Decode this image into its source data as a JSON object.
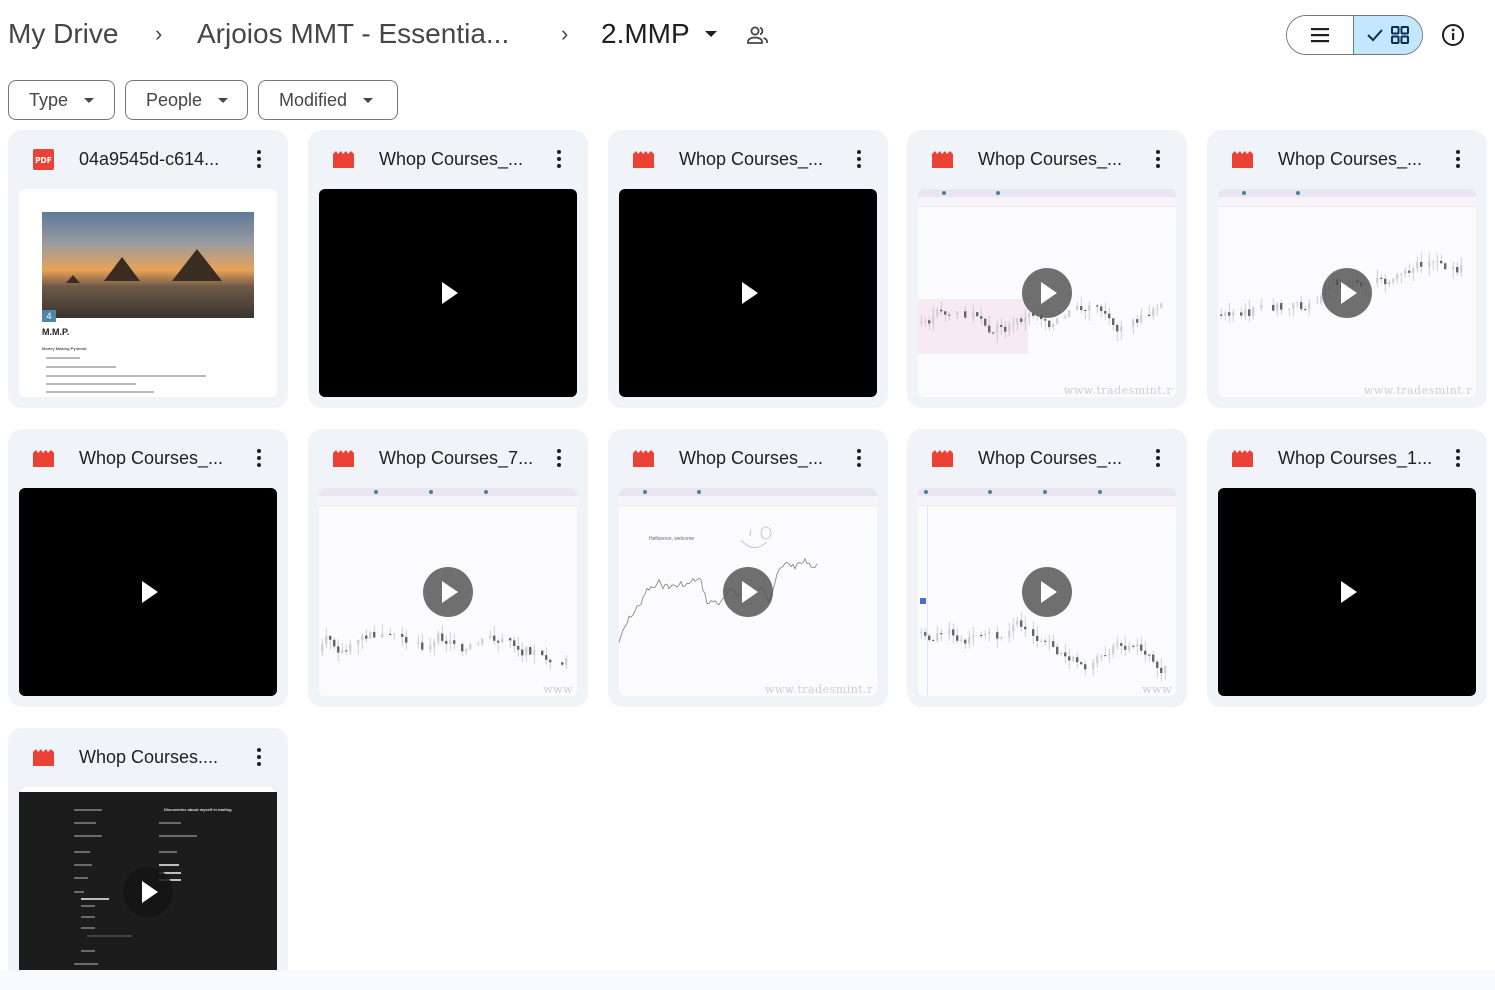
{
  "breadcrumb": {
    "items": [
      {
        "label": "My Drive"
      },
      {
        "label": "Arjoios MMT - Essentia..."
      },
      {
        "label": "2.MMP"
      }
    ],
    "separator": "›",
    "current_has_dropdown": true,
    "current_shared_icon": "shared-folder-icon"
  },
  "view_toggle": {
    "options": [
      {
        "name": "list",
        "icon": "list-icon",
        "selected": false
      },
      {
        "name": "grid",
        "icon": "grid-icon",
        "selected": true,
        "check_icon": "checkmark-icon"
      }
    ],
    "selected_color": "#c2e7ff"
  },
  "info_button": {
    "icon": "info-icon"
  },
  "filters": [
    {
      "label": "Type"
    },
    {
      "label": "People"
    },
    {
      "label": "Modified"
    }
  ],
  "files": [
    {
      "name": "04a9545d-c614...",
      "type": "pdf",
      "icon": "pdf-icon",
      "icon_text": "PDF",
      "thumbnail": "pdf-document",
      "preview": {
        "heading": "M.M.P.",
        "subtitle": "Money Making Pyramid",
        "badge": "4"
      }
    },
    {
      "name": "Whop Courses_...",
      "type": "video",
      "icon": "video-icon",
      "thumbnail": "black"
    },
    {
      "name": "Whop Courses_...",
      "type": "video",
      "icon": "video-icon",
      "thumbnail": "black"
    },
    {
      "name": "Whop Courses_...",
      "type": "video",
      "icon": "video-icon",
      "thumbnail": "chart",
      "watermark": "www.tradesmint.r"
    },
    {
      "name": "Whop Courses_...",
      "type": "video",
      "icon": "video-icon",
      "thumbnail": "chart",
      "watermark": "www.tradesmint.r"
    },
    {
      "name": "Whop Courses_...",
      "type": "video",
      "icon": "video-icon",
      "thumbnail": "black"
    },
    {
      "name": "Whop Courses_7...",
      "type": "video",
      "icon": "video-icon",
      "thumbnail": "chart",
      "watermark": "www"
    },
    {
      "name": "Whop Courses_...",
      "type": "video",
      "icon": "video-icon",
      "thumbnail": "chart",
      "watermark": "www.tradesmint.r",
      "overlay_text": "Hellooooo, welcome"
    },
    {
      "name": "Whop Courses_...",
      "type": "video",
      "icon": "video-icon",
      "thumbnail": "chart",
      "watermark": "www"
    },
    {
      "name": "Whop Courses_1...",
      "type": "video",
      "icon": "video-icon",
      "thumbnail": "black"
    },
    {
      "name": "Whop Courses....",
      "type": "video",
      "icon": "video-icon",
      "thumbnail": "dark-notes",
      "preview": {
        "heading": "Discoveries about myself in trading"
      }
    }
  ],
  "colors": {
    "card_bg": "#f0f4f9",
    "file_icon_red": "#ea4335",
    "text_primary": "#1f1f1f",
    "text_secondary": "#444746"
  }
}
